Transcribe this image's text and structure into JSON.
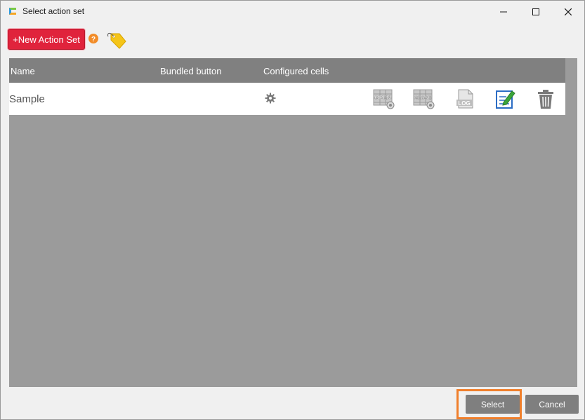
{
  "window": {
    "title": "Select action set",
    "icons": {
      "app": "app-logo-icon",
      "minimize": "minimize-icon",
      "maximize": "maximize-icon",
      "close": "close-icon"
    }
  },
  "toolbar": {
    "new_action_set_label": "+New Action Set",
    "help_icon": "help-icon",
    "tag_icon": "tag-icon"
  },
  "table": {
    "columns": [
      "Name",
      "Bundled button",
      "Configured cells"
    ],
    "rows": [
      {
        "name": "Sample",
        "bundled_button": "",
        "configured_cells_icon": "gear-icon",
        "actions": [
          "open-cells-icon",
          "close-cells-icon",
          "log-icon",
          "edit-icon",
          "trash-icon"
        ]
      }
    ]
  },
  "footer": {
    "select_label": "Select",
    "cancel_label": "Cancel"
  },
  "colors": {
    "new_button": "#e0233c",
    "header": "#808080",
    "grid_background": "#9b9b9b",
    "footer_button": "#7f7f7f",
    "highlight": "#f07f2b"
  }
}
